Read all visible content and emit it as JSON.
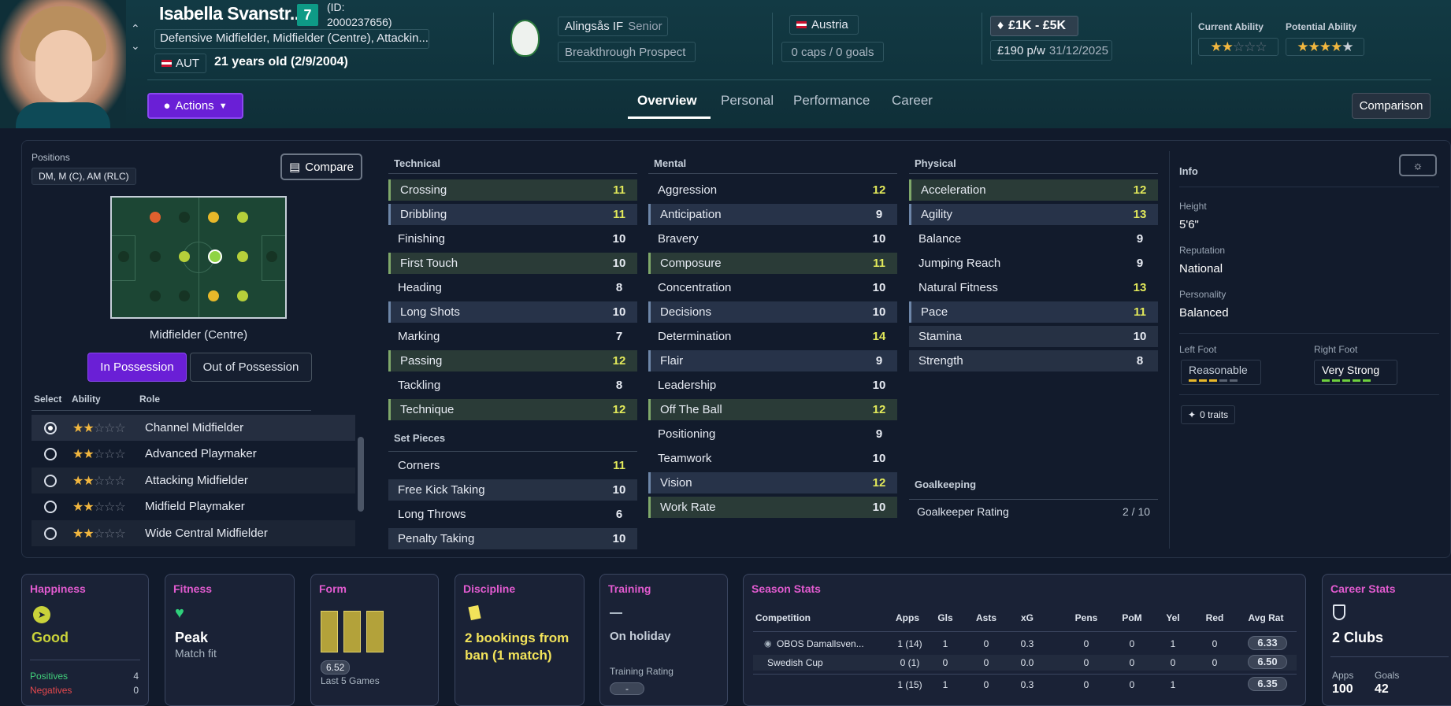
{
  "player": {
    "name": "Isabella Svanstr...",
    "squad_number": "7",
    "id_line1": "(ID:",
    "id_line2": "2000237656)",
    "positions_text": "Defensive Midfielder, Midfielder (Centre), Attackin...",
    "nationality_code": "AUT",
    "age_text": "21 years old (2/9/2004)"
  },
  "club": {
    "name": "Alingsås IF",
    "level": "Senior",
    "status": "Breakthrough Prospect"
  },
  "nation": {
    "name": "Austria",
    "caps": "0 caps / 0 goals"
  },
  "contract": {
    "value_range": "£1K - £5K",
    "wage": "£190 p/w",
    "expiry": "31/12/2025"
  },
  "ability": {
    "current_label": "Current Ability",
    "current_stars": 2,
    "potential_label": "Potential Ability",
    "potential_stars": 4.5
  },
  "nav": {
    "actions": "Actions",
    "tabs": [
      "Overview",
      "Personal",
      "Performance",
      "Career"
    ],
    "comparison": "Comparison"
  },
  "positions_panel": {
    "label": "Positions",
    "chip": "DM, M (C), AM (RLC)",
    "compare": "Compare",
    "selected_position": "Midfielder (Centre)",
    "in_possession": "In Possession",
    "out_of_possession": "Out of Possession",
    "headers": {
      "select": "Select",
      "ability": "Ability",
      "role": "Role"
    },
    "roles": [
      {
        "name": "Channel Midfielder",
        "stars": 2,
        "selected": true
      },
      {
        "name": "Advanced Playmaker",
        "stars": 2,
        "selected": false
      },
      {
        "name": "Attacking Midfielder",
        "stars": 2,
        "selected": false
      },
      {
        "name": "Midfield Playmaker",
        "stars": 2,
        "selected": false
      },
      {
        "name": "Wide Central Midfielder",
        "stars": 2,
        "selected": false
      }
    ]
  },
  "technical": {
    "title": "Technical",
    "items": [
      {
        "name": "Crossing",
        "value": "11"
      },
      {
        "name": "Dribbling",
        "value": "11"
      },
      {
        "name": "Finishing",
        "value": "10"
      },
      {
        "name": "First Touch",
        "value": "10"
      },
      {
        "name": "Heading",
        "value": "8"
      },
      {
        "name": "Long Shots",
        "value": "10"
      },
      {
        "name": "Marking",
        "value": "7"
      },
      {
        "name": "Passing",
        "value": "12"
      },
      {
        "name": "Tackling",
        "value": "8"
      },
      {
        "name": "Technique",
        "value": "12"
      }
    ]
  },
  "set_pieces": {
    "title": "Set Pieces",
    "items": [
      {
        "name": "Corners",
        "value": "11"
      },
      {
        "name": "Free Kick Taking",
        "value": "10"
      },
      {
        "name": "Long Throws",
        "value": "6"
      },
      {
        "name": "Penalty Taking",
        "value": "10"
      }
    ]
  },
  "mental": {
    "title": "Mental",
    "items": [
      {
        "name": "Aggression",
        "value": "12"
      },
      {
        "name": "Anticipation",
        "value": "9"
      },
      {
        "name": "Bravery",
        "value": "10"
      },
      {
        "name": "Composure",
        "value": "11"
      },
      {
        "name": "Concentration",
        "value": "10"
      },
      {
        "name": "Decisions",
        "value": "10"
      },
      {
        "name": "Determination",
        "value": "14"
      },
      {
        "name": "Flair",
        "value": "9"
      },
      {
        "name": "Leadership",
        "value": "10"
      },
      {
        "name": "Off The Ball",
        "value": "12"
      },
      {
        "name": "Positioning",
        "value": "9"
      },
      {
        "name": "Teamwork",
        "value": "10"
      },
      {
        "name": "Vision",
        "value": "12"
      },
      {
        "name": "Work Rate",
        "value": "10"
      }
    ]
  },
  "physical": {
    "title": "Physical",
    "items": [
      {
        "name": "Acceleration",
        "value": "12"
      },
      {
        "name": "Agility",
        "value": "13"
      },
      {
        "name": "Balance",
        "value": "9"
      },
      {
        "name": "Jumping Reach",
        "value": "9"
      },
      {
        "name": "Natural Fitness",
        "value": "13"
      },
      {
        "name": "Pace",
        "value": "11"
      },
      {
        "name": "Stamina",
        "value": "10"
      },
      {
        "name": "Strength",
        "value": "8"
      }
    ]
  },
  "goalkeeping": {
    "title": "Goalkeeping",
    "label": "Goalkeeper Rating",
    "value": "2 / 10"
  },
  "info": {
    "title": "Info",
    "height_label": "Height",
    "height": "5'6\"",
    "reputation_label": "Reputation",
    "reputation": "National",
    "personality_label": "Personality",
    "personality": "Balanced",
    "left_foot_label": "Left Foot",
    "left_foot": "Reasonable",
    "right_foot_label": "Right Foot",
    "right_foot": "Very Strong",
    "traits": "0 traits"
  },
  "cards": {
    "happiness": {
      "title": "Happiness",
      "value": "Good",
      "positives_label": "Positives",
      "positives": "4",
      "negatives_label": "Negatives",
      "negatives": "0"
    },
    "fitness": {
      "title": "Fitness",
      "value": "Peak",
      "sub": "Match fit"
    },
    "form": {
      "title": "Form",
      "rating": "6.52",
      "sub": "Last 5 Games"
    },
    "discipline": {
      "title": "Discipline",
      "value": "2 bookings from ban (1 match)"
    },
    "training": {
      "title": "Training",
      "value": "On holiday",
      "rating_label": "Training Rating",
      "rating": "-"
    },
    "season": {
      "title": "Season Stats",
      "headers": [
        "Competition",
        "Apps",
        "Gls",
        "Asts",
        "xG",
        "Pens",
        "PoM",
        "Yel",
        "Red",
        "Avg Rat"
      ],
      "rows": [
        [
          "OBOS Damallsven...",
          "1 (14)",
          "1",
          "0",
          "0.3",
          "0",
          "0",
          "1",
          "0",
          "6.33"
        ],
        [
          "Swedish Cup",
          "0 (1)",
          "0",
          "0",
          "0.0",
          "0",
          "0",
          "0",
          "0",
          "6.50"
        ]
      ],
      "total": [
        "",
        "1 (15)",
        "1",
        "0",
        "0.3",
        "0",
        "0",
        "1",
        "",
        "6.35"
      ]
    },
    "career": {
      "title": "Career Stats",
      "clubs": "2 Clubs",
      "apps_label": "Apps",
      "apps": "100",
      "goals_label": "Goals",
      "goals": "42"
    }
  },
  "colors": {
    "accent_purple": "#6a1fd6",
    "highlight_value": "#e2e95a",
    "card_title": "#e25bd0"
  }
}
